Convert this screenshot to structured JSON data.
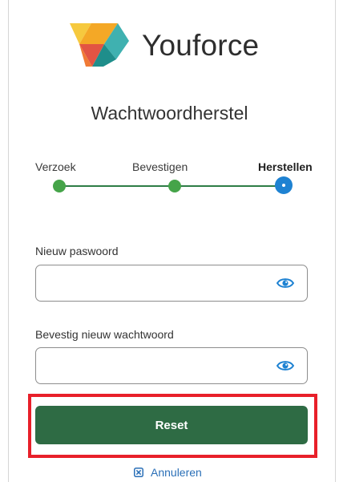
{
  "brand": {
    "name": "Youforce",
    "logo_icon": "youforce-logo-icon"
  },
  "page": {
    "title": "Wachtwoordherstel"
  },
  "steps": [
    {
      "label": "Verzoek",
      "state": "completed"
    },
    {
      "label": "Bevestigen",
      "state": "completed"
    },
    {
      "label": "Herstellen",
      "state": "current"
    }
  ],
  "form": {
    "new_password": {
      "label": "Nieuw paswoord",
      "value": "",
      "placeholder": "",
      "toggle_icon": "eye-icon"
    },
    "confirm_password": {
      "label": "Bevestig nieuw wachtwoord",
      "value": "",
      "placeholder": "",
      "toggle_icon": "eye-icon"
    },
    "reset_label": "Reset",
    "cancel_label": "Annuleren",
    "cancel_icon": "close-box-icon"
  },
  "colors": {
    "primary_button": "#2e6b44",
    "step_done": "#45a449",
    "step_current": "#1e82d2",
    "link": "#2a6fb7",
    "highlight": "#e8202a"
  }
}
